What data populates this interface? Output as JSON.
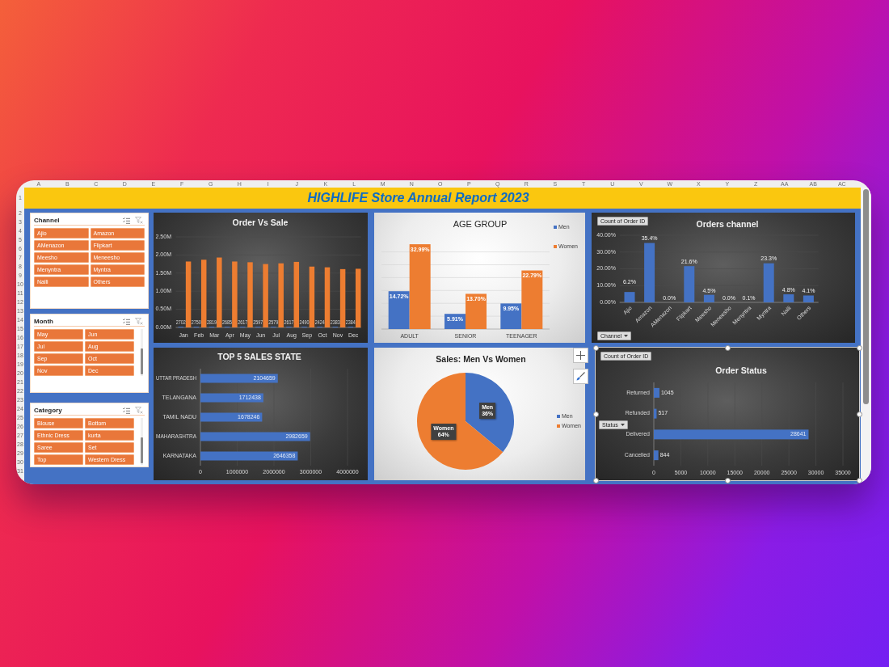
{
  "sheet": {
    "column_headers": [
      "A",
      "B",
      "C",
      "D",
      "E",
      "F",
      "G",
      "H",
      "I",
      "J",
      "K",
      "L",
      "M",
      "N",
      "O",
      "P",
      "Q",
      "R",
      "S",
      "T",
      "U",
      "V",
      "W",
      "X",
      "Y",
      "Z",
      "AA",
      "AB",
      "AC"
    ],
    "row_headers": [
      "1",
      "2",
      "3",
      "4",
      "5",
      "6",
      "7",
      "8",
      "9",
      "10",
      "11",
      "12",
      "13",
      "14",
      "15",
      "16",
      "17",
      "18",
      "19",
      "20",
      "21",
      "22",
      "23",
      "24",
      "25",
      "26",
      "27",
      "28",
      "29",
      "30",
      "31"
    ]
  },
  "title": "HIGHLIFE Store Annual Report 2023",
  "slicers": [
    {
      "title": "Channel",
      "scrollable": false,
      "items": [
        {
          "label": "Ajio",
          "selected": true
        },
        {
          "label": "Amazon",
          "selected": true
        },
        {
          "label": "AMenazon",
          "selected": true
        },
        {
          "label": "Flipkart",
          "selected": true
        },
        {
          "label": "Meesho",
          "selected": true
        },
        {
          "label": "Meneesho",
          "selected": true
        },
        {
          "label": "Menyntra",
          "selected": true
        },
        {
          "label": "Myntra",
          "selected": true
        },
        {
          "label": "Nalli",
          "selected": true
        },
        {
          "label": "Others",
          "selected": true
        }
      ]
    },
    {
      "title": "Month",
      "scrollable": true,
      "items": [
        {
          "label": "May",
          "selected": true
        },
        {
          "label": "Jun",
          "selected": true
        },
        {
          "label": "Jul",
          "selected": true
        },
        {
          "label": "Aug",
          "selected": true
        },
        {
          "label": "Sep",
          "selected": true
        },
        {
          "label": "Oct",
          "selected": true
        },
        {
          "label": "Nov",
          "selected": true
        },
        {
          "label": "Dec",
          "selected": true
        }
      ]
    },
    {
      "title": "Category",
      "scrollable": true,
      "items": [
        {
          "label": "Blouse",
          "selected": true
        },
        {
          "label": "Bottom",
          "selected": true
        },
        {
          "label": "Ethnic Dress",
          "selected": true
        },
        {
          "label": "kurta",
          "selected": true
        },
        {
          "label": "Saree",
          "selected": true
        },
        {
          "label": "Set",
          "selected": true
        },
        {
          "label": "Top",
          "selected": true
        },
        {
          "label": "Western Dress",
          "selected": true
        }
      ]
    }
  ],
  "order_vs_sale": {
    "selected": false,
    "chart_data": [
      {
        "type": "bar",
        "title": "Order Vs Sale",
        "categories": [
          "Jan",
          "Feb",
          "Mar",
          "Apr",
          "May",
          "Jun",
          "Jul",
          "Aug",
          "Sep",
          "Oct",
          "Nov",
          "Dec"
        ],
        "ylim": [
          0,
          2500000
        ],
        "yticks": [
          {
            "value": 0,
            "label": "0.00M"
          },
          {
            "value": 500000,
            "label": "0.50M"
          },
          {
            "value": 1000000,
            "label": "1.00M"
          },
          {
            "value": 1500000,
            "label": "1.50M"
          },
          {
            "value": 2000000,
            "label": "2.00M"
          },
          {
            "value": 2500000,
            "label": "2.50M"
          }
        ],
        "grid": true,
        "series": [
          {
            "color": "#4472c4",
            "values": [
              2702,
              2750,
              2819,
              2685,
              2617,
              2597,
              2579,
              2617,
              2490,
              2424,
              2383,
              2384
            ],
            "data_labels": true
          },
          {
            "color": "#ed7d31",
            "values": [
              1820000,
              1870000,
              1930000,
              1820000,
              1800000,
              1750000,
              1770000,
              1810000,
              1680000,
              1660000,
              1610000,
              1620000
            ]
          }
        ]
      }
    ]
  },
  "age_group": {
    "selected": false,
    "chart_data": [
      {
        "type": "bar",
        "title": "AGE GROUP",
        "categories": [
          "ADULT",
          "SENIOR",
          "TEENAGER"
        ],
        "legend": "top-right",
        "grid": true,
        "series": [
          {
            "name": "Men",
            "color": "#4472c4",
            "values": [
              14.72,
              5.91,
              9.95
            ],
            "value_labels": [
              "14.72%",
              "5.91%",
              "9.95%"
            ]
          },
          {
            "name": "Women",
            "color": "#ed7d31",
            "values": [
              32.99,
              13.7,
              22.79
            ],
            "value_labels": [
              "32.99%",
              "13.70%",
              "22.79%"
            ]
          }
        ]
      }
    ]
  },
  "orders_channel": {
    "selected": false,
    "field_buttons": [
      {
        "label": "Count of Order ID",
        "kind": "value"
      },
      {
        "label": "Channel",
        "kind": "axis"
      }
    ],
    "chart_data": [
      {
        "type": "bar",
        "title": "Orders channel",
        "categories": [
          "Ajio",
          "Amazon",
          "AMenazon",
          "Flipkart",
          "Meesho",
          "Meneesho",
          "Menyntra",
          "Myntra",
          "Nalli",
          "Others"
        ],
        "ylim": [
          0,
          40
        ],
        "yticks": [
          {
            "value": 0,
            "label": "0.00%"
          },
          {
            "value": 10,
            "label": "10.00%"
          },
          {
            "value": 20,
            "label": "20.00%"
          },
          {
            "value": 30,
            "label": "30.00%"
          },
          {
            "value": 40,
            "label": "40.00%"
          }
        ],
        "grid": true,
        "color": "#4472c4",
        "values": [
          6.2,
          35.4,
          0,
          21.6,
          4.5,
          0,
          0.1,
          23.3,
          4.8,
          4.1
        ],
        "value_labels": [
          "6.2%",
          "35.4%",
          "0.0%",
          "21.6%",
          "4.5%",
          "0.0%",
          "0.1%",
          "23.3%",
          "4.8%",
          "4.1%"
        ]
      }
    ]
  },
  "top_sales_state": {
    "selected": false,
    "chart_data": [
      {
        "type": "bar",
        "orientation": "horizontal",
        "title": "TOP 5 SALES STATE",
        "categories": [
          "UTTAR PRADESH",
          "TELANGANA",
          "TAMIL NADU",
          "MAHARASHTRA",
          "KARNATAKA"
        ],
        "values": [
          2104659,
          1712438,
          1678246,
          2982659,
          2646358
        ],
        "xlim": [
          0,
          4000000
        ],
        "xticks": [
          0,
          1000000,
          2000000,
          3000000,
          4000000
        ],
        "grid": true,
        "data_labels": true,
        "color": "#4472c4"
      }
    ]
  },
  "sales_men_women": {
    "selected": false,
    "chart_data": [
      {
        "type": "pie",
        "title": "Sales: Men Vs Women",
        "categories": [
          "Men",
          "Women"
        ],
        "values": [
          36,
          64
        ],
        "colors": [
          "#4472c4",
          "#ed7d31"
        ],
        "value_labels": [
          "36%",
          "64%"
        ],
        "legend": "right"
      }
    ]
  },
  "order_status": {
    "selected": true,
    "field_buttons": [
      {
        "label": "Count of Order ID",
        "kind": "value"
      },
      {
        "label": "Status",
        "kind": "axis"
      }
    ],
    "chart_data": [
      {
        "type": "bar",
        "orientation": "horizontal",
        "title": "Order Status",
        "categories": [
          "Returned",
          "Refunded",
          "Delivered",
          "Cancelled"
        ],
        "values": [
          1045,
          517,
          28641,
          844
        ],
        "xlim": [
          0,
          35000
        ],
        "xticks": [
          0,
          5000,
          10000,
          15000,
          20000,
          25000,
          30000,
          35000
        ],
        "grid": true,
        "data_labels": true,
        "color": "#4472c4"
      }
    ]
  }
}
